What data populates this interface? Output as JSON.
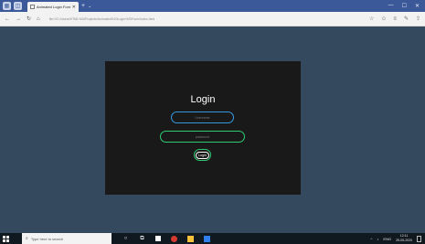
{
  "browser": {
    "tab_title": "Animated Login Form",
    "tab_close": "✕",
    "new_tab": "+",
    "new_tab_dropdown": "⌄",
    "window_controls": [
      "—",
      "☐",
      "✕"
    ],
    "url": "file:///C:/Users/HTML%20Projects/Animated%20Login%20Form/index.html",
    "nav": [
      "←",
      "→",
      "↻",
      "⌂"
    ],
    "tools": [
      "☆",
      "✩",
      "≡",
      "✎",
      "⇪"
    ]
  },
  "login": {
    "title": "Login",
    "username_placeholder": "Username",
    "password_placeholder": "password",
    "button_label": "Login"
  },
  "taskbar": {
    "search_placeholder": "Type here to search",
    "language": "ENG",
    "time": "12:11",
    "date": "25-05-2020"
  },
  "colors": {
    "page_bg": "#34495e",
    "card_bg": "#191919",
    "username_border": "#3498db",
    "password_border": "#2ecc71"
  }
}
